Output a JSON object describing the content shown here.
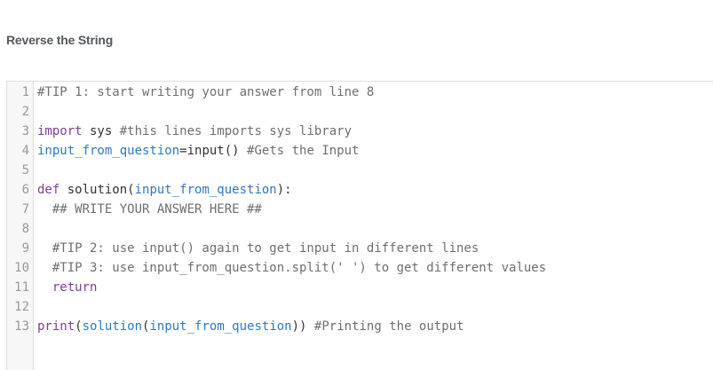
{
  "title": "Reverse the String",
  "editor": {
    "lines": [
      {
        "n": "1",
        "tokens": [
          {
            "t": "#TIP 1: start writing your answer from line 8",
            "c": "cm"
          }
        ]
      },
      {
        "n": "2",
        "tokens": []
      },
      {
        "n": "3",
        "tokens": [
          {
            "t": "import",
            "c": "kw"
          },
          {
            "t": " sys ",
            "c": "id"
          },
          {
            "t": "#this lines imports sys library",
            "c": "cm"
          }
        ]
      },
      {
        "n": "4",
        "tokens": [
          {
            "t": "input_from_question",
            "c": "fn"
          },
          {
            "t": "=",
            "c": "id"
          },
          {
            "t": "input",
            "c": "id"
          },
          {
            "t": "() ",
            "c": "id"
          },
          {
            "t": "#Gets the Input",
            "c": "cm"
          }
        ]
      },
      {
        "n": "5",
        "tokens": []
      },
      {
        "n": "6",
        "tokens": [
          {
            "t": "def",
            "c": "kw"
          },
          {
            "t": " solution(",
            "c": "id"
          },
          {
            "t": "input_from_question",
            "c": "fn"
          },
          {
            "t": "):",
            "c": "id"
          }
        ]
      },
      {
        "n": "7",
        "tokens": [
          {
            "t": "  ## WRITE YOUR ANSWER HERE ##",
            "c": "cm"
          }
        ]
      },
      {
        "n": "8",
        "tokens": []
      },
      {
        "n": "9",
        "tokens": [
          {
            "t": "  #TIP 2: use input() again to get input in different lines",
            "c": "cm"
          }
        ]
      },
      {
        "n": "10",
        "tokens": [
          {
            "t": "  #TIP 3: use input_from_question.split(' ') to get different values",
            "c": "cm"
          }
        ]
      },
      {
        "n": "11",
        "tokens": [
          {
            "t": "  ",
            "c": "id"
          },
          {
            "t": "return",
            "c": "kw"
          }
        ]
      },
      {
        "n": "12",
        "tokens": []
      },
      {
        "n": "13",
        "tokens": [
          {
            "t": "print",
            "c": "kw"
          },
          {
            "t": "(",
            "c": "id"
          },
          {
            "t": "solution",
            "c": "fn"
          },
          {
            "t": "(",
            "c": "id"
          },
          {
            "t": "input_from_question",
            "c": "fn"
          },
          {
            "t": ")) ",
            "c": "id"
          },
          {
            "t": "#Printing the output",
            "c": "cm"
          }
        ]
      }
    ]
  }
}
